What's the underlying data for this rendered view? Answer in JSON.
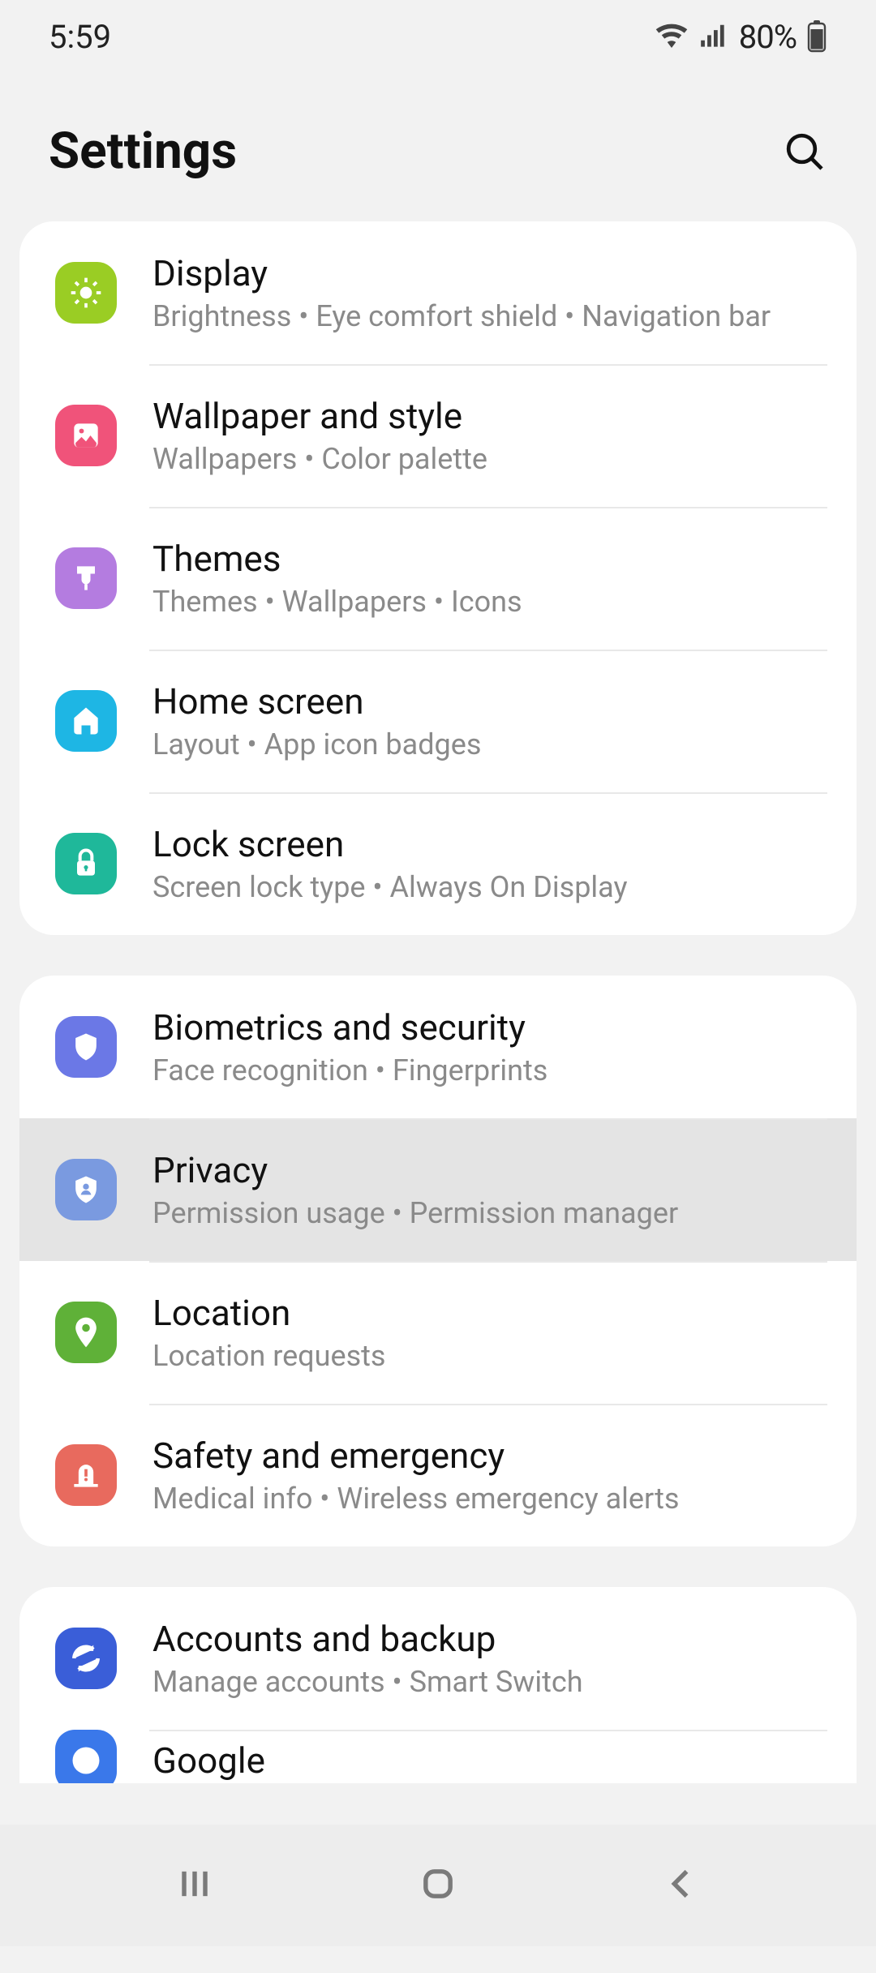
{
  "status": {
    "time": "5:59",
    "battery": "80%"
  },
  "header": {
    "title": "Settings"
  },
  "groups": [
    {
      "items": [
        {
          "key": "display",
          "title": "Display",
          "sub": "Brightness  •  Eye comfort shield  •  Navigation bar",
          "color": "#9acd24",
          "icon": "sun"
        },
        {
          "key": "wallpaper",
          "title": "Wallpaper and style",
          "sub": "Wallpapers  •  Color palette",
          "color": "#f0537a",
          "icon": "image"
        },
        {
          "key": "themes",
          "title": "Themes",
          "sub": "Themes  •  Wallpapers  •  Icons",
          "color": "#b47ce0",
          "icon": "brush"
        },
        {
          "key": "home",
          "title": "Home screen",
          "sub": "Layout  •  App icon badges",
          "color": "#1eb6e4",
          "icon": "home"
        },
        {
          "key": "lock",
          "title": "Lock screen",
          "sub": "Screen lock type  •  Always On Display",
          "color": "#1fb89a",
          "icon": "lock"
        }
      ]
    },
    {
      "items": [
        {
          "key": "biometrics",
          "title": "Biometrics and security",
          "sub": "Face recognition  •  Fingerprints",
          "color": "#6b78e6",
          "icon": "shield"
        },
        {
          "key": "privacy",
          "title": "Privacy",
          "sub": "Permission usage  •  Permission manager",
          "color": "#7a9ae0",
          "icon": "shield-person",
          "pressed": true
        },
        {
          "key": "location",
          "title": "Location",
          "sub": "Location requests",
          "color": "#5fb138",
          "icon": "pin"
        },
        {
          "key": "safety",
          "title": "Safety and emergency",
          "sub": "Medical info  •  Wireless emergency alerts",
          "color": "#e86a5e",
          "icon": "siren"
        }
      ]
    },
    {
      "items": [
        {
          "key": "accounts",
          "title": "Accounts and backup",
          "sub": "Manage accounts  •  Smart Switch",
          "color": "#3a5ed8",
          "icon": "sync"
        }
      ],
      "peek": {
        "key": "google",
        "title": "Google",
        "color": "#3a78ea",
        "icon": "google"
      }
    }
  ]
}
